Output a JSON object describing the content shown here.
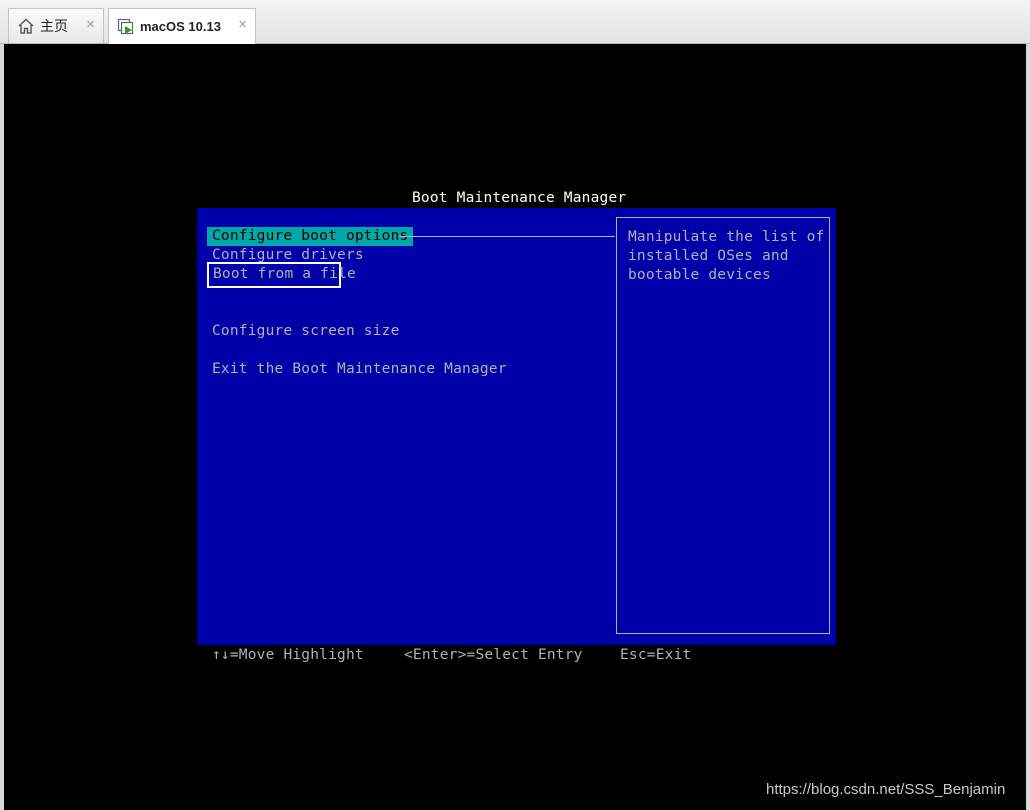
{
  "tabs": [
    {
      "label": "主页",
      "icon": "home-icon",
      "active": false
    },
    {
      "label": "macOS 10.13",
      "icon": "vm-running-icon",
      "active": true
    }
  ],
  "tab_close_glyph": "×",
  "bios": {
    "title": "Boot Maintenance Manager",
    "menu": [
      {
        "label": "Configure boot options",
        "selected": true
      },
      {
        "label": "Configure drivers"
      },
      {
        "label": "Boot from a file",
        "highlighted_box": true
      },
      {
        "label": "Configure screen size"
      },
      {
        "label": "Exit the Boot Maintenance Manager"
      }
    ],
    "help_lines": [
      "Manipulate the list of",
      "installed OSes and",
      "bootable devices"
    ],
    "footer": {
      "move": "↑↓=Move Highlight",
      "select": "<Enter>=Select Entry",
      "exit": "Esc=Exit"
    },
    "colors": {
      "panel_bg": "#0000a8",
      "selected_bg": "#00a8a8",
      "text": "#b0b0b8",
      "title": "#ffffff"
    }
  },
  "watermark": "https://blog.csdn.net/SSS_Benjamin"
}
